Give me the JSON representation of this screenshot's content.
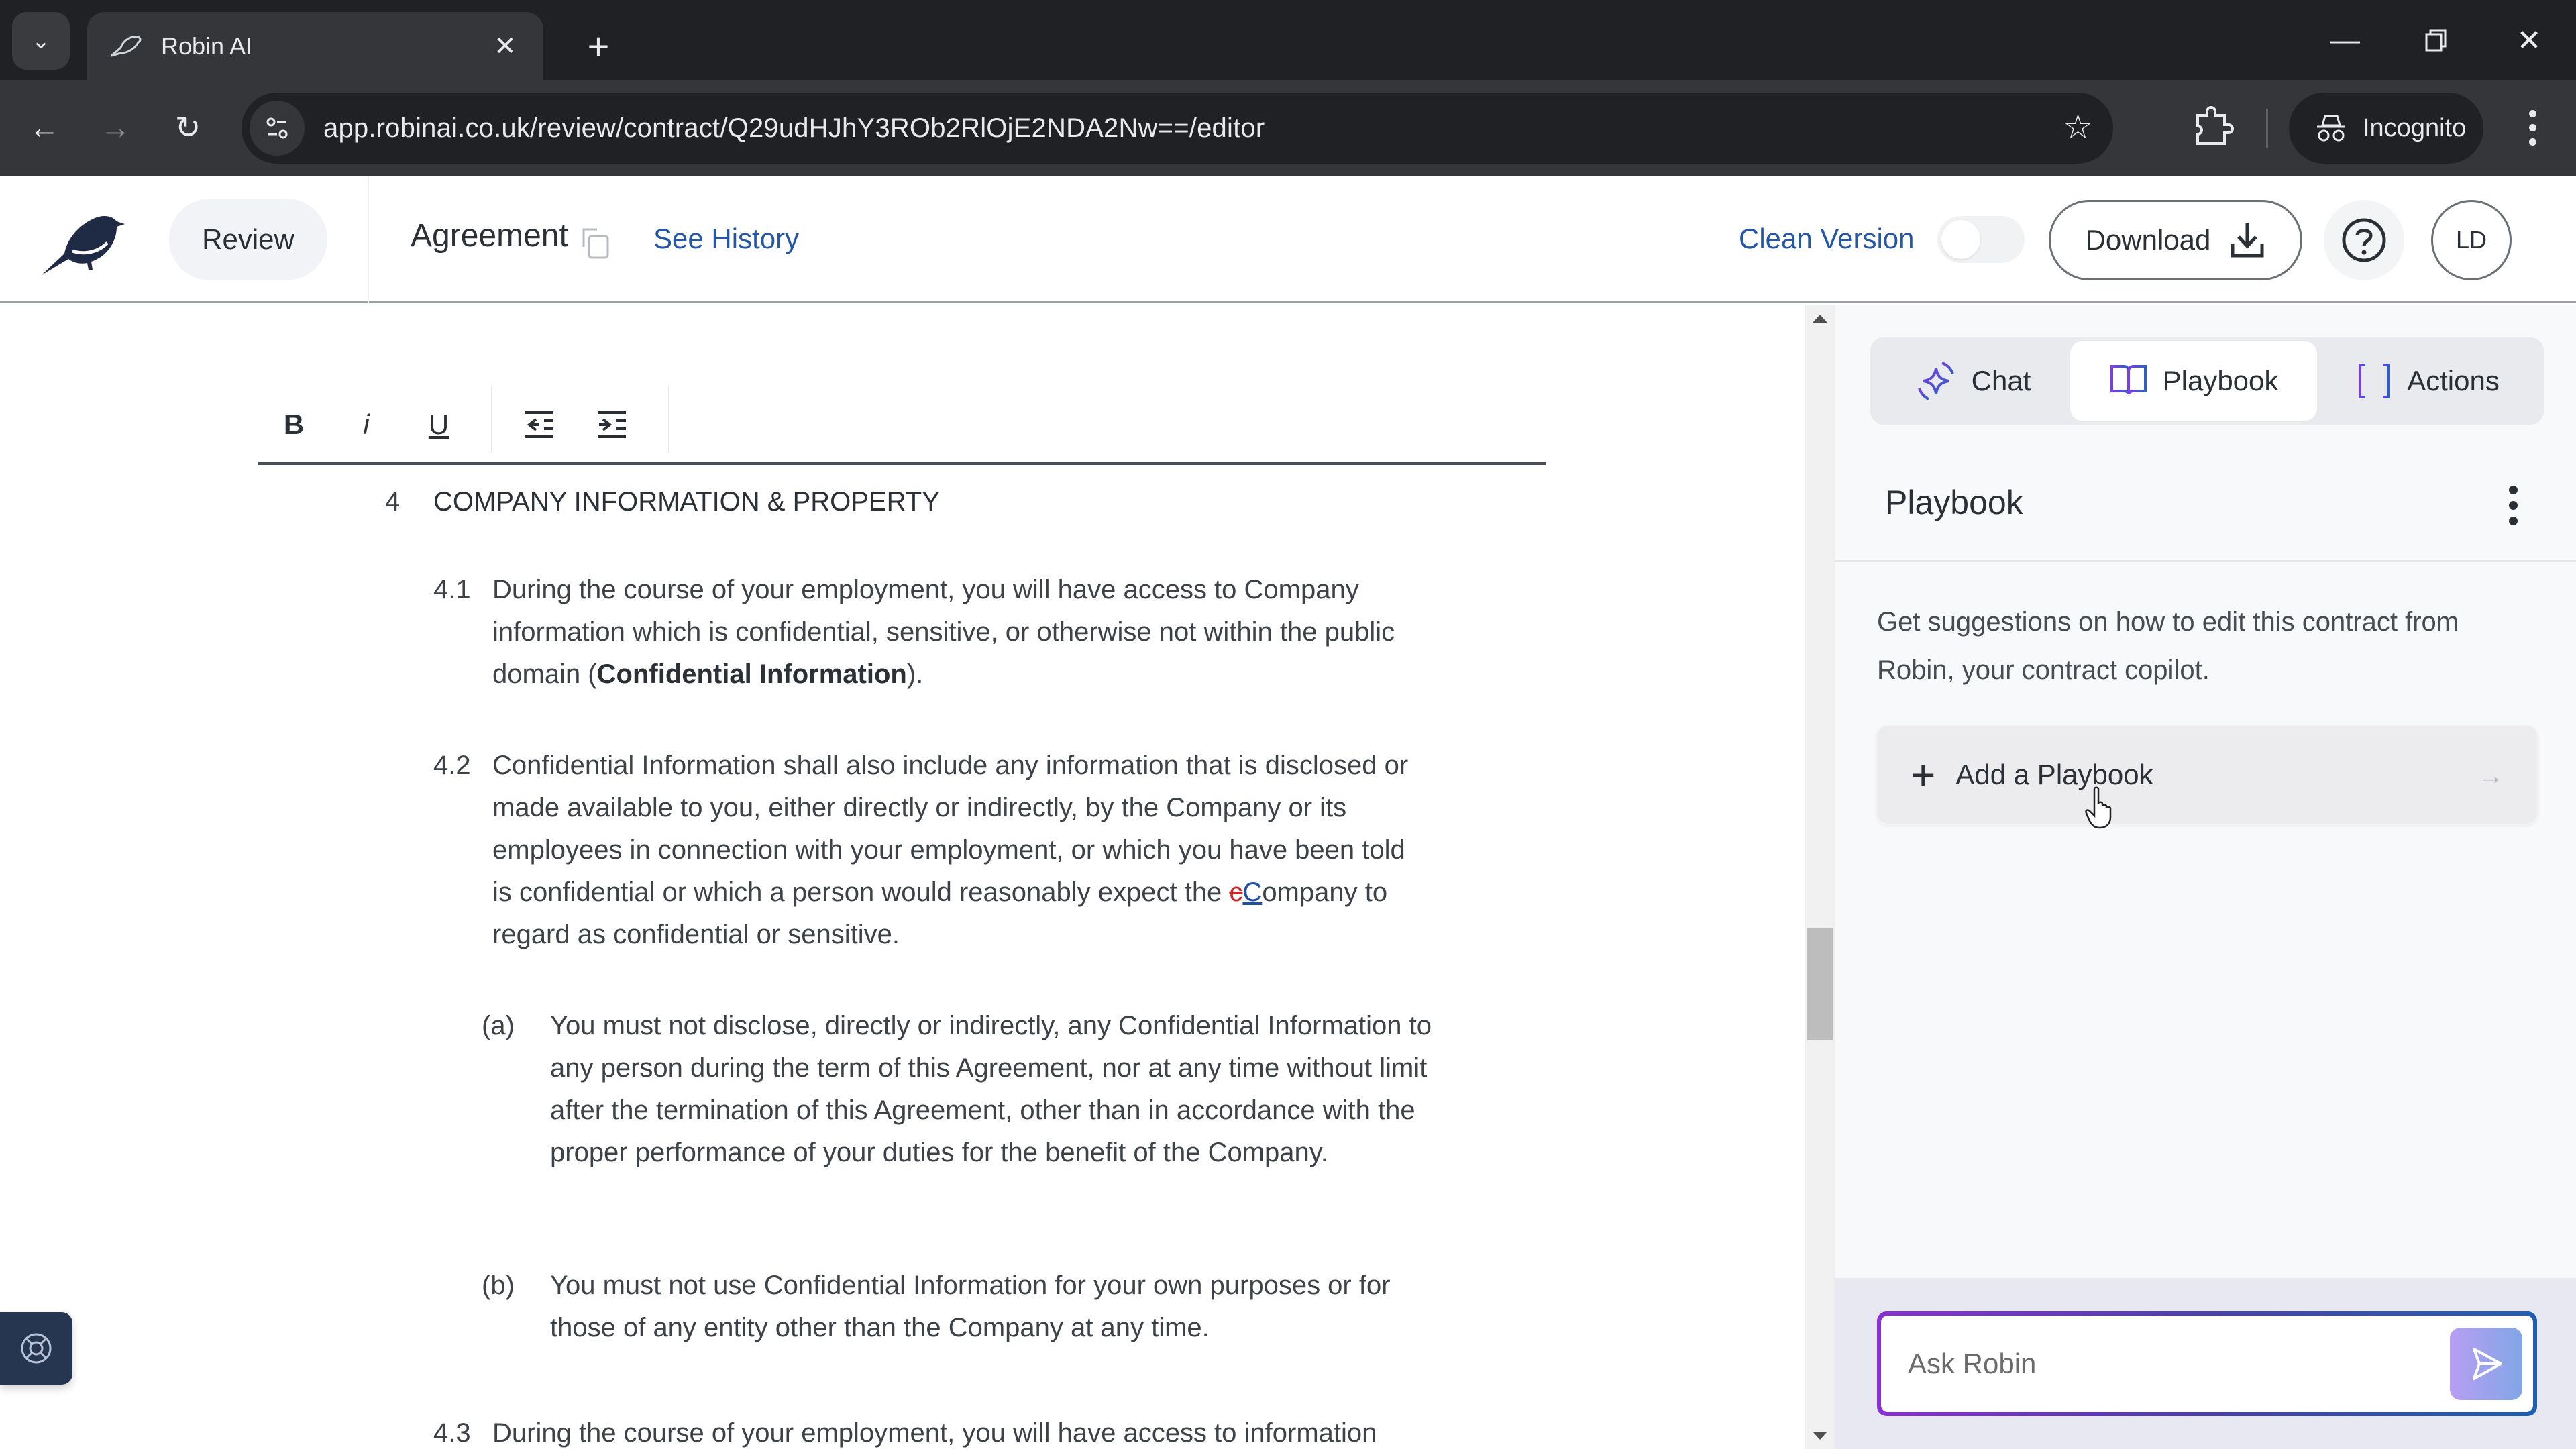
{
  "browser": {
    "tab_title": "Robin AI",
    "url": "app.robinai.co.uk/review/contract/Q29udHJhY3ROb2RlOjE2NDA2Nw==/editor",
    "incognito_label": "Incognito",
    "icons": {
      "tab_list": "chevron-down-icon",
      "tab_close": "close-icon",
      "new_tab": "plus-icon",
      "back": "arrow-left-icon",
      "forward": "arrow-right-icon",
      "reload": "reload-icon",
      "site_info": "tune-icon",
      "bookmark": "star-icon",
      "extensions": "puzzle-icon",
      "incognito": "incognito-icon",
      "menu": "more-vertical-icon",
      "minimize": "minimize-icon",
      "restore": "restore-icon",
      "close_window": "close-icon"
    }
  },
  "header": {
    "nav_label": "Review",
    "document_title": "Agreement",
    "see_history_label": "See History",
    "clean_version_label": "Clean Version",
    "clean_version_on": false,
    "download_label": "Download",
    "avatar_initials": "LD",
    "colors": {
      "link": "#2457a8",
      "logo": "#1f2a44"
    }
  },
  "editor": {
    "toolbar": {
      "bold": "B",
      "italic": "i",
      "underline": "U"
    },
    "section": {
      "number": "4",
      "title": "COMPANY INFORMATION & PROPERTY"
    },
    "clauses": [
      {
        "number": "4.1",
        "text_before": "During the course of your employment, you will have access to Company information which is confidential, sensitive, or otherwise not within the public domain (",
        "bold": "Confidential Information",
        "text_after": ")."
      },
      {
        "number": "4.2",
        "text": "Confidential Information shall also include any information that is disclosed or made available to you, either directly or indirectly, by the Company or its employees in connection with your employment, or which you have been told is confidential or which a person would reasonably expect the ",
        "deleted": "c",
        "inserted": "C",
        "text_after": "ompany to regard as confidential or sensitive."
      },
      {
        "number": "(a)",
        "text": "You must not disclose, directly or indirectly, any Confidential Information to any person during the term of this Agreement, nor at any time without limit after the termination of this Agreement, other than in accordance with the proper performance of your duties for the benefit of the Company."
      },
      {
        "number": "(b)",
        "text": "You must not use Confidential Information for your own purposes or for those of any entity other than the Company at any time."
      },
      {
        "number": "4.3",
        "text": "During the course of your employment, you will have access to information"
      }
    ],
    "track_changes_colors": {
      "deleted": "#c62828",
      "inserted": "#1e4fa8"
    }
  },
  "panel": {
    "tabs": [
      {
        "label": "Chat",
        "icon": "sparkle-icon",
        "active": false
      },
      {
        "label": "Playbook",
        "icon": "book-open-icon",
        "active": true
      },
      {
        "label": "Actions",
        "icon": "brackets-icon",
        "active": false
      }
    ],
    "title": "Playbook",
    "description": "Get suggestions on how to edit this contract from Robin, your contract copilot.",
    "add_playbook_label": "Add a Playbook",
    "ask_placeholder": "Ask Robin",
    "ask_value": ""
  }
}
